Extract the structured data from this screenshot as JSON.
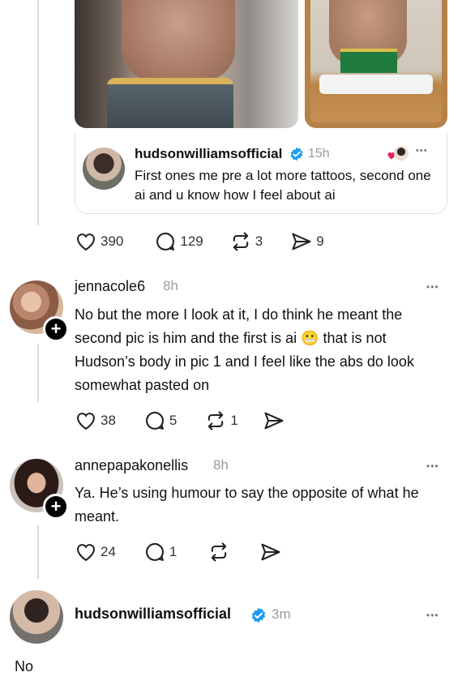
{
  "quoted_post": {
    "username": "hudsonwilliamsofficial",
    "time": "15h",
    "text": "First ones me pre a lot more tattoos, second one ai and u know how I feel about ai",
    "more": "•••"
  },
  "main_actions": {
    "likes": "390",
    "replies": "129",
    "reposts": "3",
    "shares": "9"
  },
  "comments": [
    {
      "username": "jennacole6",
      "time": "8h",
      "text": "No but the more I look at it, I do think he meant the second pic is him and the first is ai 😬 that is not Hudson’s body in pic 1 and I feel like the abs do look somewhat pasted on",
      "likes": "38",
      "replies": "5",
      "reposts": "1",
      "shares": "",
      "more": "•••"
    },
    {
      "username": "annepapakonellis",
      "time": "8h",
      "text": "Ya. He’s using humour to say the opposite of what he meant.",
      "likes": "24",
      "replies": "1",
      "reposts": "",
      "shares": "",
      "more": "•••"
    }
  ],
  "reply_box": {
    "username": "hudsonwilliamsofficial",
    "time": "3m",
    "text": "No",
    "more": "•••"
  },
  "colors": {
    "verified": "#1d9bf0",
    "heart": "#e0245e",
    "muted": "#9a9a9a"
  }
}
